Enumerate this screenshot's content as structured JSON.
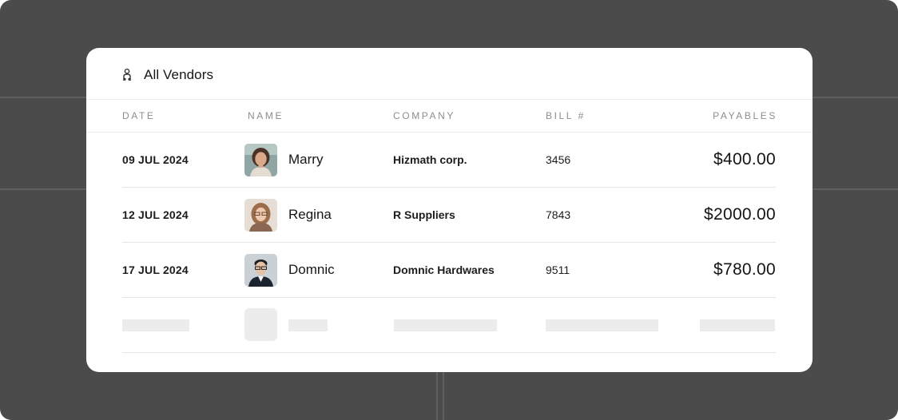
{
  "header": {
    "title": "All Vendors",
    "icon": "vendors-icon"
  },
  "columns": {
    "date": "DATE",
    "name": "NAME",
    "company": "COMPANY",
    "bill": "BILL #",
    "payables": "PAYABLES"
  },
  "rows": [
    {
      "date": "09 JUL 2024",
      "name": "Marry",
      "company": "Hizmath corp.",
      "bill": "3456",
      "payables": "$400.00",
      "avatar": "avatar-marry"
    },
    {
      "date": "12 JUL 2024",
      "name": "Regina",
      "company": "R Suppliers",
      "bill": "7843",
      "payables": "$2000.00",
      "avatar": "avatar-regina"
    },
    {
      "date": "17 JUL 2024",
      "name": "Domnic",
      "company": "Domnic Hardwares",
      "bill": "9511",
      "payables": "$780.00",
      "avatar": "avatar-domnic"
    }
  ],
  "colors": {
    "backdrop": "#4b4b4b",
    "card": "#ffffff",
    "skeleton": "#ececec"
  }
}
